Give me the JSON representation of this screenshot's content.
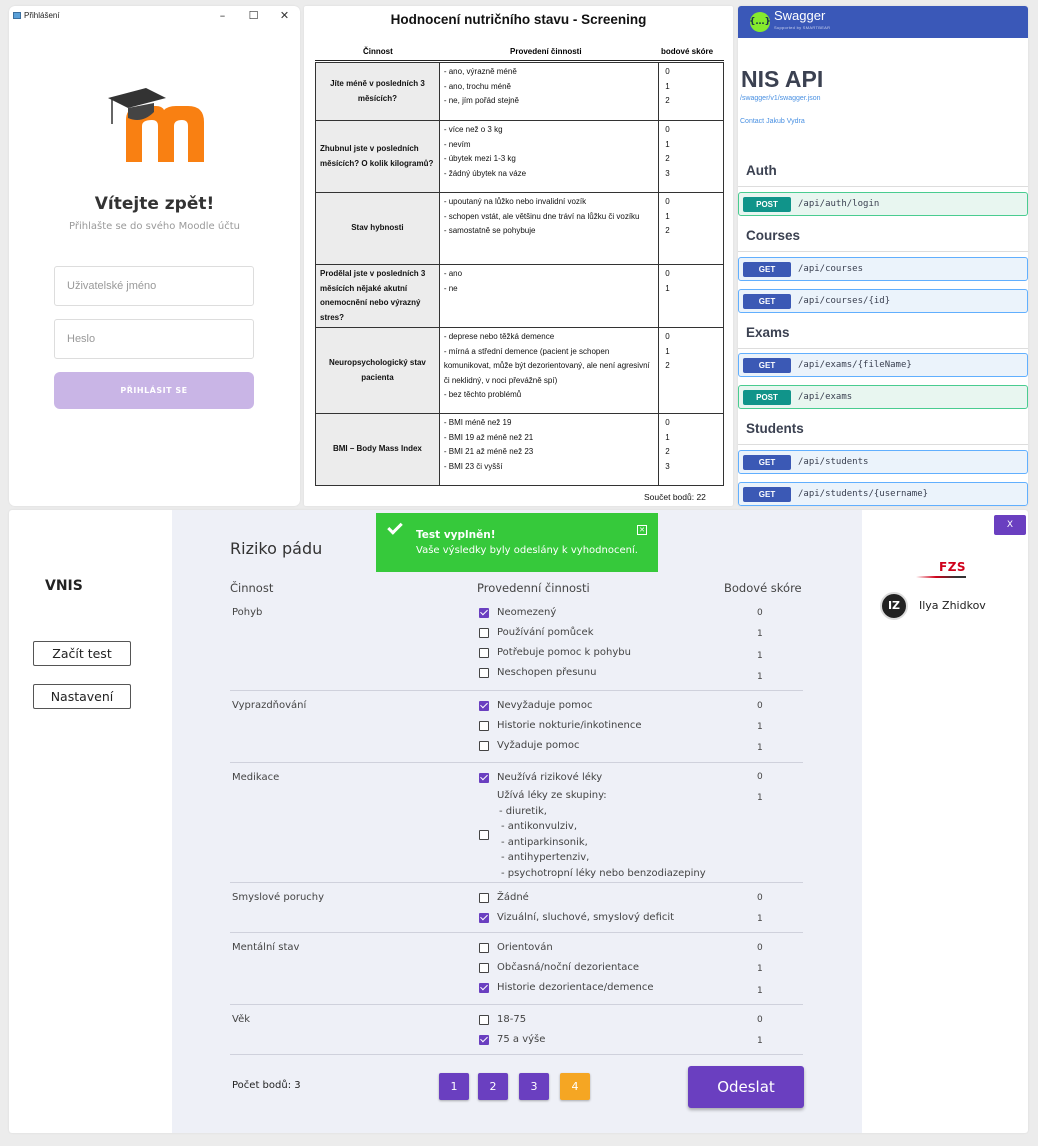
{
  "login": {
    "window_title": "Přihlášení",
    "win_minimize": "–",
    "win_maximize": "☐",
    "win_close": "✕",
    "welcome": "Vítejte zpět!",
    "subtitle": "Přihlašte se do svého Moodle účtu",
    "username_placeholder": "Uživatelské jméno",
    "password_placeholder": "Heslo",
    "submit_label": "PŘIHLÁSIT SE",
    "brand_color": "#f98012"
  },
  "nutrition": {
    "title": "Hodnocení nutričního stavu - Screening",
    "headers": [
      "Činnost",
      "Provedení činnosti",
      "bodové skóre"
    ],
    "rows": [
      {
        "activity": "Jíte méně v posledních 3 měsících?",
        "options": [
          "- ano, výrazně méně",
          "- ano, trochu méně",
          "- ne, jím pořád stejně"
        ],
        "scores": [
          "0",
          "1",
          "2"
        ]
      },
      {
        "activity": "Zhubnul jste v posledních měsících? O kolik kilogramů?",
        "options": [
          "- více než o 3 kg",
          "- nevím",
          "- úbytek mezi 1-3 kg",
          "- žádný úbytek na váze"
        ],
        "scores": [
          "0",
          "1",
          "2",
          "3"
        ]
      },
      {
        "activity": "Stav hybnosti",
        "options": [
          "- upoutaný na lůžko nebo invalidní vozík",
          "- schopen vstát, ale většinu dne tráví na lůžku či vozíku",
          "- samostatně se pohybuje"
        ],
        "scores": [
          "0",
          "1",
          "2"
        ]
      },
      {
        "activity": "Prodělal jste v posledních 3 měsících nějaké akutní onemocnění nebo výrazný stres?",
        "options": [
          "- ano",
          "- ne"
        ],
        "scores": [
          "0",
          "1"
        ]
      },
      {
        "activity": "Neuropsychologický stav pacienta",
        "options": [
          "- deprese nebo těžká demence",
          "- mírná a střední demence (pacient je schopen komunikovat, může být dezorientovaný, ale není agresivní či neklidný, v noci převážně spí)",
          "- bez těchto problémů"
        ],
        "scores": [
          "0",
          "1",
          "2"
        ]
      },
      {
        "activity": "BMI – Body Mass Index",
        "options": [
          "- BMI méně než 19",
          "- BMI 19 až méně než 21",
          "- BMI 21 až méně než 23",
          "- BMI 23 či vyšší"
        ],
        "scores": [
          "0",
          "1",
          "2",
          "3"
        ]
      }
    ],
    "sum": "Součet bodů: 22"
  },
  "swagger": {
    "brand": "Swagger",
    "brand_sub": "Supported by SMARTBEAR",
    "logo_glyph": "{…}",
    "api_title": "NIS API",
    "spec_link": "/swagger/v1/swagger.json",
    "contact_link": "Contact Jakub Vydra",
    "sections": {
      "auth": "Auth",
      "courses": "Courses",
      "exams": "Exams",
      "students": "Students"
    },
    "ops": [
      {
        "method": "POST",
        "path": "/api/auth/login"
      },
      {
        "method": "GET",
        "path": "/api/courses"
      },
      {
        "method": "GET",
        "path": "/api/courses/{id}"
      },
      {
        "method": "GET",
        "path": "/api/exams/{fileName}"
      },
      {
        "method": "POST",
        "path": "/api/exams"
      },
      {
        "method": "GET",
        "path": "/api/students"
      },
      {
        "method": "GET",
        "path": "/api/students/{username}"
      }
    ]
  },
  "app": {
    "brand": "VNIS",
    "nav": {
      "start_test": "Začít test",
      "settings": "Nastavení"
    },
    "title": "Riziko pádu",
    "columns": [
      "Činnost",
      "Provedenní činnosti",
      "Bodové skóre"
    ],
    "categories": {
      "pohyb": "Pohyb",
      "vyprazdnovani": "Vyprazdňování",
      "medikace": "Medikace",
      "smysl": "Smyslové poruchy",
      "mental": "Mentální stav",
      "vek": "Věk"
    },
    "options": {
      "pohyb": [
        {
          "label": "Neomezený",
          "score": "0",
          "checked": true
        },
        {
          "label": "Používání pomůcek",
          "score": "1",
          "checked": false
        },
        {
          "label": "Potřebuje pomoc k pohybu",
          "score": "1",
          "checked": false
        },
        {
          "label": "Neschopen přesunu",
          "score": "1",
          "checked": false
        }
      ],
      "vyprazdnovani": [
        {
          "label": "Nevyžaduje pomoc",
          "score": "0",
          "checked": true
        },
        {
          "label": "Historie nokturie/inkotinence",
          "score": "1",
          "checked": false
        },
        {
          "label": "Vyžaduje pomoc",
          "score": "1",
          "checked": false
        }
      ],
      "medikace": [
        {
          "label": "Neužívá rizikové léky",
          "score": "0",
          "checked": true
        },
        {
          "label": "Užívá léky ze skupiny:",
          "score": "1",
          "checked": false
        }
      ],
      "smysl": [
        {
          "label": "Žádné",
          "score": "0",
          "checked": false
        },
        {
          "label": "Vizuální, sluchové, smyslový deficit",
          "score": "1",
          "checked": true
        }
      ],
      "mental": [
        {
          "label": "Orientován",
          "score": "0",
          "checked": false
        },
        {
          "label": "Občasná/noční dezorientace",
          "score": "1",
          "checked": false
        },
        {
          "label": "Historie dezorientace/demence",
          "score": "1",
          "checked": true
        }
      ],
      "vek": [
        {
          "label": "18-75",
          "score": "0",
          "checked": false
        },
        {
          "label": "75 a výše",
          "score": "1",
          "checked": true
        }
      ]
    },
    "med_groups": [
      "- diuretik,",
      "- antikonvulziv,",
      "- antiparkinsonik,",
      "- antihypertenziv,",
      "- psychotropní léky nebo benzodiazepiny"
    ],
    "total": "Počet bodů: 3",
    "pages": [
      "1",
      "2",
      "3",
      "4"
    ],
    "current_page": "4",
    "submit": "Odeslat",
    "toast": {
      "title": "Test vyplněn!",
      "message": "Vaše výsledky byly odeslány k vyhodnocení.",
      "close": "✕"
    },
    "close_button": "X",
    "org_logo": "FZS",
    "user_initials": "IZ",
    "user_name": "Ilya Zhidkov",
    "accent_color": "#6a3fc0"
  }
}
